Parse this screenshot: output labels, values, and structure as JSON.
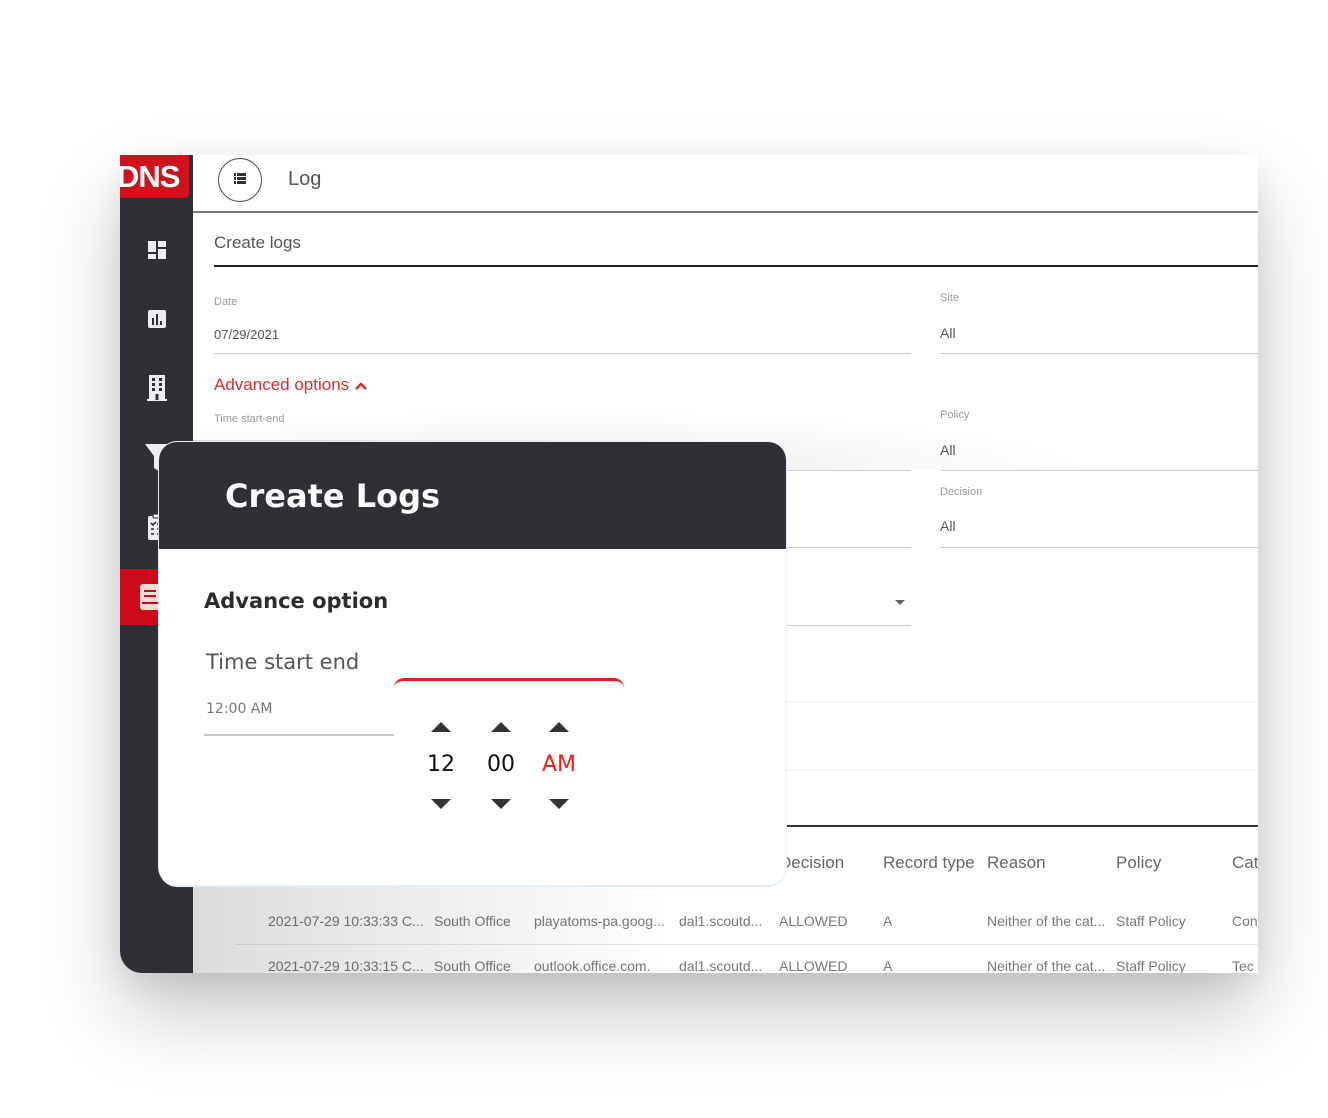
{
  "app": {
    "logo_text": "DNS",
    "page_title": "Log",
    "section_title": "Create logs"
  },
  "sidebar": {
    "items": [
      {
        "icon": "dashboard-icon",
        "active": false
      },
      {
        "icon": "bar-chart-icon",
        "active": false
      },
      {
        "icon": "building-icon",
        "active": false
      },
      {
        "icon": "filter-icon",
        "active": false
      },
      {
        "icon": "clipboard-checklist-icon",
        "active": false
      },
      {
        "icon": "log-document-icon",
        "active": true
      }
    ]
  },
  "form": {
    "date": {
      "label": "Date",
      "value": "07/29/2021"
    },
    "site": {
      "label": "Site",
      "value": "All"
    },
    "advanced_toggle": "Advanced options",
    "time_start_end": {
      "label": "Time start-end"
    },
    "policy": {
      "label": "Policy",
      "value": "All"
    },
    "decision": {
      "label": "Decision",
      "value": "All"
    }
  },
  "table": {
    "columns": [
      "Decision",
      "Record type",
      "Reason",
      "Policy",
      "Cat"
    ],
    "rows": [
      {
        "time": "2021-07-29 10:33:33 C...",
        "site": "South Office",
        "domain": "playatoms-pa.goog...",
        "resolver": "dal1.scoutd...",
        "decision": "ALLOWED",
        "record_type": "A",
        "reason": "Neither of the cat...",
        "policy": "Staff Policy",
        "category": "Con"
      },
      {
        "time": "2021-07-29 10:33:15 C...",
        "site": "South Office",
        "domain": "outlook.office.com.",
        "resolver": "dal1.scoutd...",
        "decision": "ALLOWED",
        "record_type": "A",
        "reason": "Neither of the cat...",
        "policy": "Staff Policy",
        "category": "Tec"
      }
    ]
  },
  "dialog": {
    "title": "Create Logs",
    "subtitle": "Advance option",
    "time_label": "Time start end",
    "time_value": "12:00 AM",
    "picker": {
      "hour": "12",
      "minute": "00",
      "period": "AM"
    }
  },
  "colors": {
    "brand_red": "#d1111b",
    "sidebar_dark": "#302f35",
    "accent_red": "#ef1b1b",
    "link_red": "#d32f2f"
  }
}
